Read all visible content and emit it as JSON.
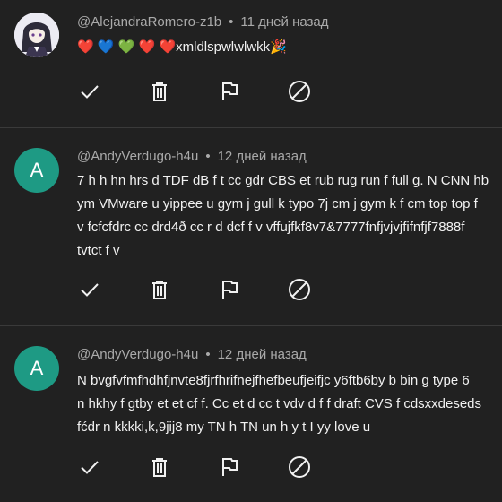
{
  "comments": [
    {
      "author": "@AlejandraRomero-z1b",
      "separator": "•",
      "time": "11 дней назад",
      "avatar_letter": "",
      "avatar_color": "#e8e4f4",
      "lines": [],
      "emoji_line": {
        "hearts": [
          "❤️",
          "💙",
          "💚",
          "❤️",
          "❤️"
        ],
        "text": "xmldlspwlwlwkk",
        "party": "🎉"
      }
    },
    {
      "author": "@AndyVerdugo-h4u",
      "separator": "•",
      "time": "12 дней назад",
      "avatar_letter": "A",
      "avatar_color": "#1e9a84",
      "lines": [
        "7 h h hn hrs d TDF dB f t cc gdr CBS et rub rug run f full g. N CNN hb",
        "ym VMware u yippee u gym j gull k typo 7j cm j gym k f cm top top f",
        "v fcfcfdrc cc drd4ð cc r d dcf f v vffujfkf8v7&7777fnfjvjvjfifnfjf7888f",
        "tvtct f v"
      ]
    },
    {
      "author": "@AndyVerdugo-h4u",
      "separator": "•",
      "time": "12 дней назад",
      "avatar_letter": "A",
      "avatar_color": "#1e9a84",
      "lines": [
        "N bvgfvfmfhdhfjnvte8fjrfhrifnejfhefbeufjeifjc y6ftb6by b bin g type 6",
        "n hkhy f gtby et et cf f. Cc et d cc t vdv d f f draft CVS f cdsxxdeseds",
        "fćdr n kkkki,k,9jij8 my TN h TN un h y t I yy love u"
      ]
    }
  ],
  "actions": [
    "check-icon",
    "trash-icon",
    "flag-icon",
    "block-icon"
  ],
  "colors": {
    "background": "#212121",
    "text": "#f1f1f1",
    "meta": "#aaaaaa",
    "divider": "#3a3a3a"
  }
}
